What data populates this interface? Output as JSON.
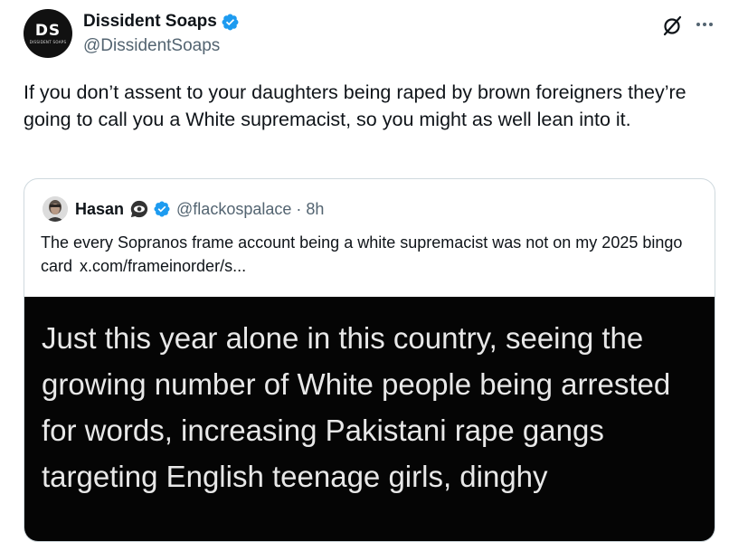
{
  "author": {
    "avatar_monogram": "DS",
    "avatar_subtext": "DISSIDENT SOAPS",
    "display_name": "Dissident Soaps",
    "handle": "@DissidentSoaps",
    "verified": true
  },
  "icons": {
    "grok": "grok-icon",
    "more": "more-icon",
    "verified": "verified-badge-icon",
    "emoji": "eye-speech-bubble-emoji"
  },
  "tweet": {
    "text": "If you don’t assent to your daughters being raped by brown foreigners they’re going to call you a White supremacist, so you might as well lean into it."
  },
  "quote": {
    "display_name": "Hasan",
    "handle": "@flackospalace",
    "separator": "·",
    "time": "8h",
    "text": "The every Sopranos frame account being a white supremacist was not on my 2025 bingo card",
    "link": "x.com/frameinorder/s...",
    "media_text": "Just this year alone in this country, seeing the growing number of White people being arrested for words, increasing Pakistani rape gangs targeting English teenage girls, dinghy"
  },
  "colors": {
    "verified_blue": "#1d9bf0",
    "secondary_text": "#536471",
    "border": "#cfd9de",
    "media_bg": "#050505"
  }
}
